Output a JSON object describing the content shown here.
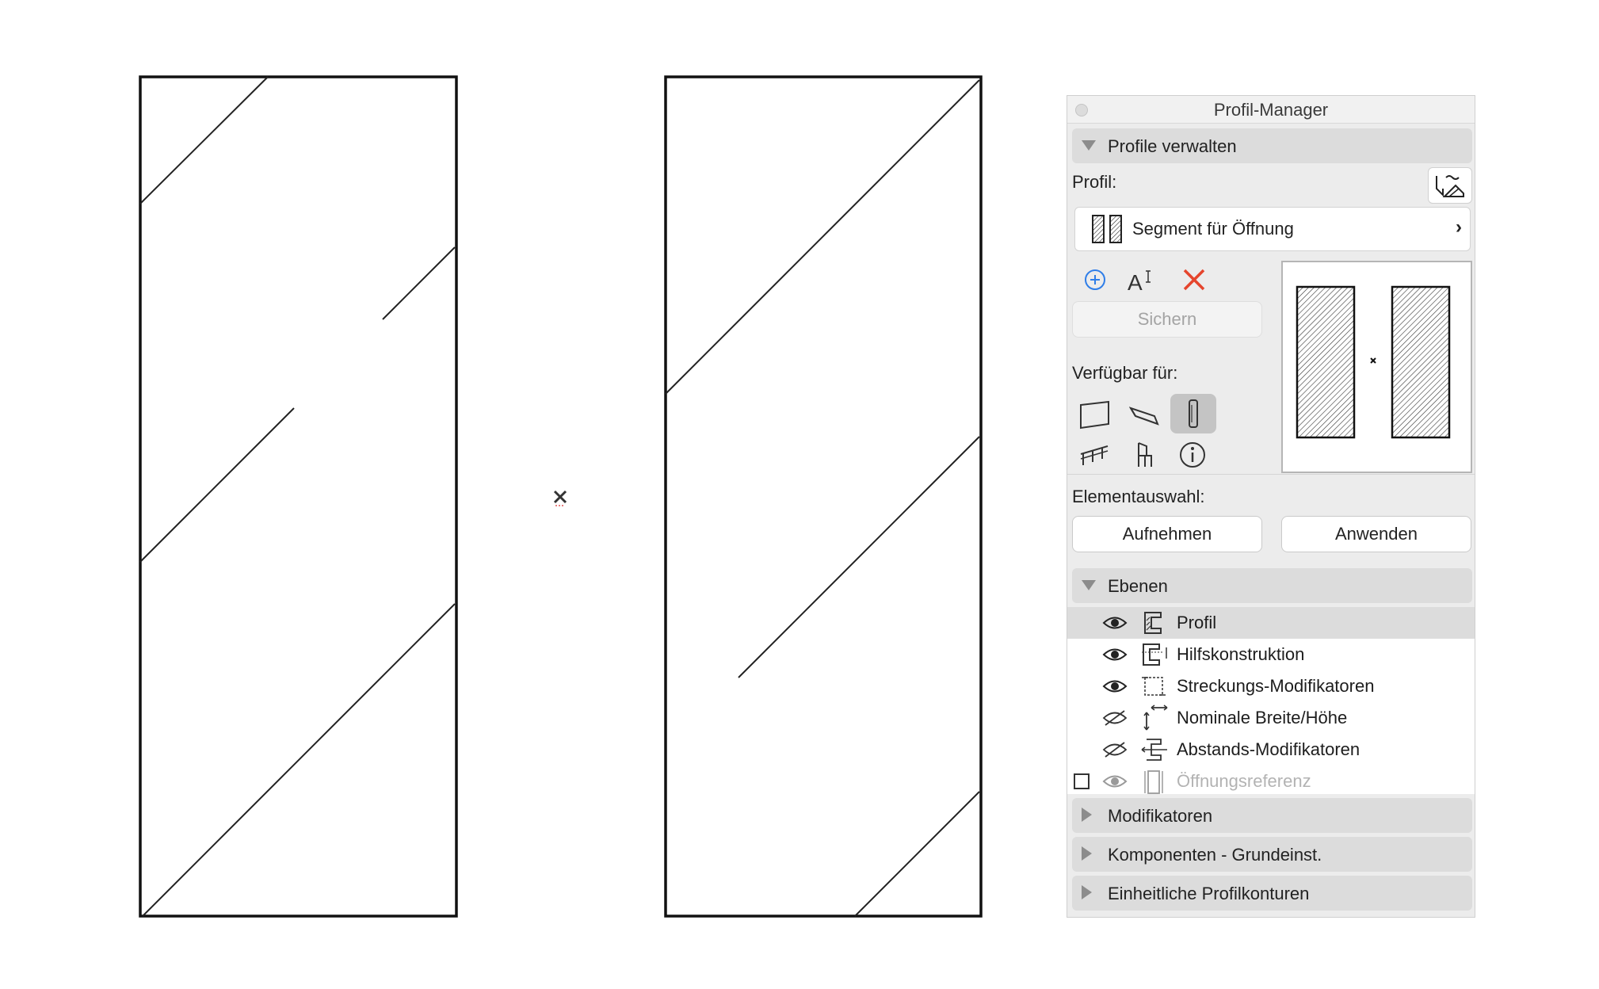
{
  "window": {
    "title": "Profil-Manager"
  },
  "manage_section": {
    "heading": "Profile verwalten",
    "profile_label": "Profil:",
    "profile_name": "Segment für Öffnung",
    "save_label": "Sichern",
    "available_label": "Verfügbar für:",
    "element_selection_label": "Elementauswahl:",
    "pick_up_label": "Aufnehmen",
    "apply_label": "Anwenden"
  },
  "layers_section": {
    "heading": "Ebenen",
    "rows": [
      {
        "name": "Profil",
        "visible": true,
        "selected": true,
        "icon": "profile-layer-icon"
      },
      {
        "name": "Hilfskonstruktion",
        "visible": true,
        "selected": false,
        "icon": "construction-layer-icon"
      },
      {
        "name": "Streckungs-Modifikatoren",
        "visible": true,
        "selected": false,
        "icon": "stretch-modifier-icon"
      },
      {
        "name": "Nominale Breite/Höhe",
        "visible": false,
        "selected": false,
        "icon": "nominal-size-icon"
      },
      {
        "name": "Abstands-Modifikatoren",
        "visible": false,
        "selected": false,
        "icon": "offset-modifier-icon"
      },
      {
        "name": "Öffnungsreferenz",
        "visible": true,
        "selected": false,
        "dimmed": true,
        "checkbox": false,
        "icon": "opening-reference-icon"
      }
    ]
  },
  "collapsed_sections": {
    "modifiers": "Modifikatoren",
    "components": "Komponenten - Grundeinst.",
    "contours": "Einheitliche Profilkonturen"
  },
  "colors": {
    "delete": "#e5452d",
    "add": "#2f7ee8",
    "active_toggle": "#c4c4c4"
  }
}
